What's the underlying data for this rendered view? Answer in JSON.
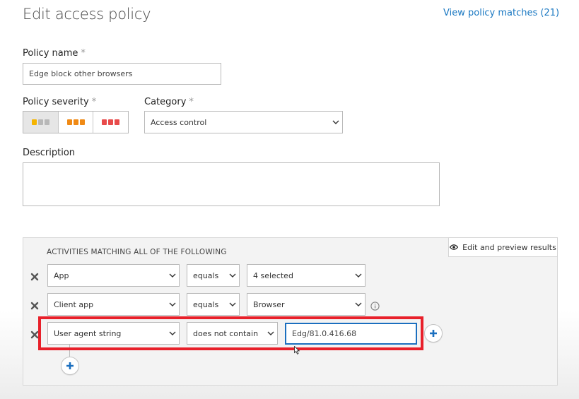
{
  "header": {
    "title": "Edit access policy",
    "view_matches_link": "View policy matches (21)"
  },
  "policy_name": {
    "label": "Policy name",
    "required_marker": "*",
    "value": "Edge block other browsers"
  },
  "policy_severity": {
    "label": "Policy severity",
    "required_marker": "*",
    "options": [
      {
        "name": "low",
        "color": "#f5b400",
        "selected": true
      },
      {
        "name": "medium",
        "color": "#f08a15",
        "selected": false
      },
      {
        "name": "high",
        "color": "#e84b4b",
        "selected": false
      }
    ],
    "inactive_color": "#b8b8b8"
  },
  "category": {
    "label": "Category",
    "required_marker": "*",
    "value": "Access control"
  },
  "description": {
    "label": "Description",
    "value": ""
  },
  "filters": {
    "heading": "ACTIVITIES MATCHING ALL OF THE FOLLOWING",
    "preview_button": "Edit and preview results",
    "rows": [
      {
        "field": "App",
        "operator": "equals",
        "value": "4 selected"
      },
      {
        "field": "Client app",
        "operator": "equals",
        "value": "Browser"
      },
      {
        "field": "User agent string",
        "operator": "does not contain",
        "value": "Edg/81.0.416.68"
      }
    ]
  },
  "colors": {
    "link": "#1a78c2",
    "highlight": "#e8202a",
    "focus_border": "#1b6fbf",
    "plus_icon": "#1b6fbf"
  }
}
